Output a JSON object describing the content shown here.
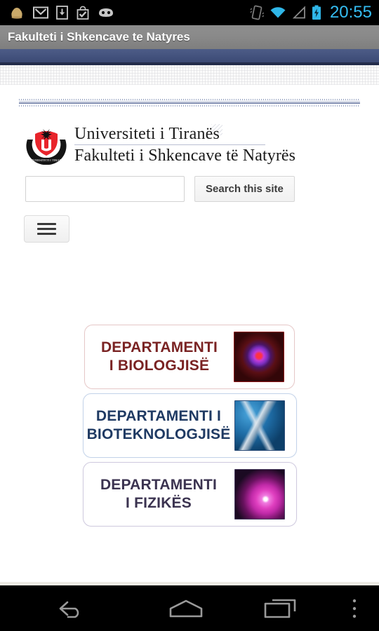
{
  "statusbar": {
    "time": "20:55",
    "left_icons": [
      {
        "name": "bag-icon",
        "glyph": "bag"
      },
      {
        "name": "gmail-icon",
        "glyph": "gmail-m"
      },
      {
        "name": "download-icon",
        "glyph": "download-box"
      },
      {
        "name": "shopping-bag-check-icon",
        "glyph": "bag-check"
      },
      {
        "name": "android-face-icon",
        "glyph": "android-head"
      }
    ],
    "right_icons": [
      {
        "name": "vibrate-icon",
        "glyph": "vibrate-phone"
      },
      {
        "name": "wifi-icon",
        "glyph": "wifi-full"
      },
      {
        "name": "cellular-signal-icon",
        "glyph": "signal-triangle-empty"
      },
      {
        "name": "battery-charging-icon",
        "glyph": "battery-bolt"
      }
    ],
    "colors": {
      "accent": "#35bdf2",
      "background": "#000000",
      "icon_gray": "#bdbdbd"
    }
  },
  "titlebar": {
    "title": "Fakulteti i Shkencave te Natyres",
    "background_top": "#8d8d8d",
    "background_bottom": "#7e7e7e",
    "text_color": "#ffffff"
  },
  "navband": {
    "color": "#42517c",
    "underline_color": "#232c4a"
  },
  "site": {
    "logo": {
      "name": "university-of-tirana-seal",
      "shield_color": "#e8242b",
      "ring_color": "#1a1a1a",
      "ring_text": "UNIVERSITETI I TIRANES"
    },
    "heading_line1": "Universiteti i Tiranës",
    "heading_line2": "Fakulteti i Shkencave të Natyrës",
    "heading_color": "#1b1b1b"
  },
  "search": {
    "value": "",
    "placeholder": "",
    "button_label": "Search this site"
  },
  "menu": {
    "label": "",
    "icon": "hamburger-icon",
    "bars": 3
  },
  "departments": [
    {
      "label": "DEPARTAMENTI I BIOLOGJISË",
      "line1": "DEPARTAMENTI",
      "line2": "I BIOLOGJISË",
      "text_color": "#7a2323",
      "border_color": "#e7c9c9",
      "thumb_name": "biology-cell-thumbnail"
    },
    {
      "label": "DEPARTAMENTI I BIOTEKNOLOGJISË",
      "line1": "DEPARTAMENTI I",
      "line2": "BIOTEKNOLOGJISË",
      "text_color": "#1f3a63",
      "border_color": "#c3d3ea",
      "thumb_name": "biotechnology-dna-thumbnail"
    },
    {
      "label": "DEPARTAMENTI I FIZIKËS",
      "line1": "DEPARTAMENTI",
      "line2": "I FIZIKËS",
      "text_color": "#3b3350",
      "border_color": "#cfcadf",
      "thumb_name": "physics-nebula-thumbnail"
    }
  ],
  "navbar": {
    "back": "back-icon",
    "home": "home-icon",
    "recents": "recent-apps-icon",
    "more": "overflow-menu-icon",
    "icon_color": "#9a9a9a"
  }
}
